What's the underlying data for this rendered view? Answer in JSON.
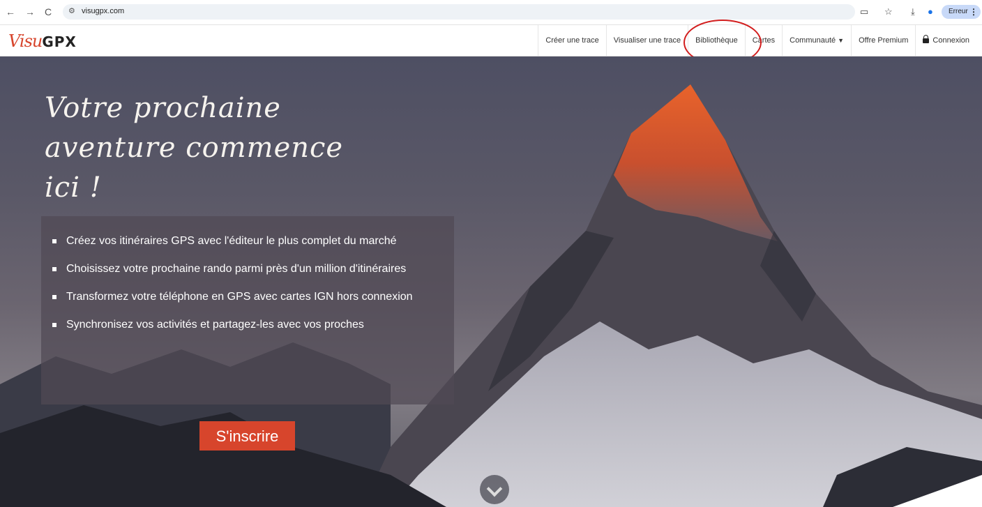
{
  "browser": {
    "back": "←",
    "forward": "→",
    "reload": "C",
    "url": "visugpx.com",
    "profile_label": "Erreur"
  },
  "navbar": {
    "logo_script": "Visu",
    "logo_bold": "GPX",
    "menu": [
      {
        "label": "Créer une trace"
      },
      {
        "label": "Visualiser une trace"
      },
      {
        "label": "Bibliothèque"
      },
      {
        "label": "Cartes"
      },
      {
        "label": "Communauté"
      },
      {
        "label": "Offre Premium"
      },
      {
        "label": "Connexion"
      }
    ]
  },
  "hero": {
    "title_line1": "Votre prochaine",
    "title_line2": "aventure commence",
    "title_line3": "ici !",
    "features": [
      "Créez vos itinéraires GPS avec l'éditeur le plus complet du marché",
      "Choisissez votre prochaine rando parmi près d'un million d'itinéraires",
      "Transformez votre téléphone en GPS avec cartes IGN hors connexion",
      "Synchronisez vos activités et partagez-les avec vos proches"
    ],
    "cta_label": "S'inscrire"
  },
  "colors": {
    "brand": "#d7452c",
    "highlight_circle": "#d21e1e"
  }
}
